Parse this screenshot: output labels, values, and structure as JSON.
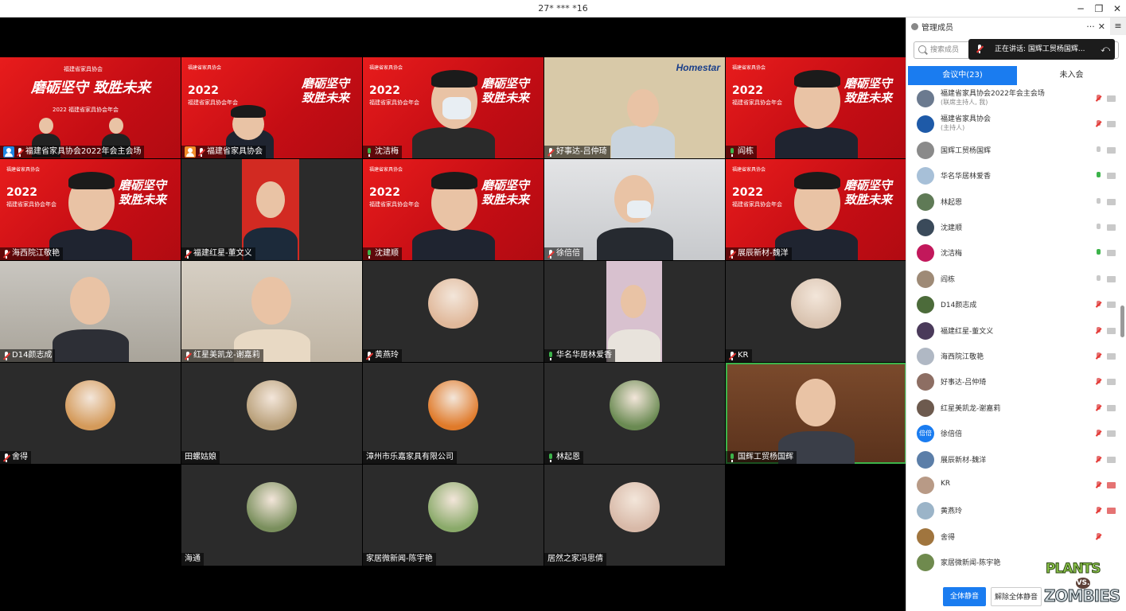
{
  "window": {
    "title": "27* *** *16"
  },
  "grid": {
    "tiles": [
      {
        "name": "福建省家具协会2022年会主会场",
        "mic": "muted",
        "host": "blue",
        "bg": "red"
      },
      {
        "name": "福建省家具协会",
        "mic": "muted",
        "host": "orange",
        "bg": "red"
      },
      {
        "name": "沈洁梅",
        "mic": "on",
        "bg": "red"
      },
      {
        "name": "好事达-吕仲琦",
        "mic": "muted",
        "bg": "pattern"
      },
      {
        "name": "阎栋",
        "mic": "on",
        "bg": "red"
      },
      {
        "name": "海西院江敬艳",
        "mic": "muted",
        "bg": "red"
      },
      {
        "name": "福建红星-董文义",
        "mic": "muted",
        "bg": "dark"
      },
      {
        "name": "沈建顺",
        "mic": "on",
        "bg": "red"
      },
      {
        "name": "徐倍倍",
        "mic": "muted",
        "bg": "office"
      },
      {
        "name": "展辰新材-魏洋",
        "mic": "muted",
        "bg": "red"
      },
      {
        "name": "D14颜志成",
        "mic": "muted",
        "bg": "room"
      },
      {
        "name": "红星美凯龙-谢嘉莉",
        "mic": "muted",
        "bg": "shelf"
      },
      {
        "name": "黄燕玲",
        "mic": "muted",
        "bg": "dark"
      },
      {
        "name": "华名华居林爱香",
        "mic": "on",
        "bg": "dark"
      },
      {
        "name": "KR",
        "mic": "muted",
        "bg": "dark"
      },
      {
        "name": "舍得",
        "mic": "muted",
        "bg": "dark"
      },
      {
        "name": "田螺姑娘",
        "mic": "",
        "bg": "dark"
      },
      {
        "name": "漳州市乐嘉家具有限公司",
        "mic": "",
        "bg": "dark"
      },
      {
        "name": "林起恩",
        "mic": "on",
        "bg": "dark"
      },
      {
        "name": "国辉工贸杨国辉",
        "mic": "on",
        "bg": "wood"
      },
      {
        "name": "海通",
        "mic": "",
        "bg": "dark"
      },
      {
        "name": "家居微新闻-陈宇艳",
        "mic": "",
        "bg": "dark"
      },
      {
        "name": "居然之家冯思倩",
        "mic": "",
        "bg": "dark"
      }
    ],
    "banner": {
      "year": "2022",
      "sub": "福建省家具协会年会",
      "slogan": "磨砺坚守 致胜未来",
      "logo": "福建省家具协会",
      "main_caption": "2022 福建省家具协会年会",
      "homestar": "Homestar"
    }
  },
  "panel": {
    "title": "管理成员",
    "more": "···",
    "close": "✕",
    "side": "≡",
    "search_placeholder": "搜索成员",
    "speaking": "正在讲话: 国辉工贸杨国辉...",
    "tabs": [
      {
        "label": "会议中(23)",
        "active": true
      },
      {
        "label": "未入会",
        "active": false
      }
    ],
    "members": [
      {
        "name": "福建省家具协会2022年会主会场",
        "role": "(联席主持人, 我)",
        "mic": "muted",
        "cam": "on",
        "color": "#6b7a8f"
      },
      {
        "name": "福建省家具协会",
        "role": "(主持人)",
        "mic": "muted",
        "cam": "on",
        "color": "#1e5aa8"
      },
      {
        "name": "国辉工贸杨国辉",
        "role": "",
        "mic": "idle",
        "cam": "on",
        "color": "#8a8a8a"
      },
      {
        "name": "华名华居林爱香",
        "role": "",
        "mic": "on",
        "cam": "on",
        "color": "#a7c0d8"
      },
      {
        "name": "林起恩",
        "role": "",
        "mic": "idle",
        "cam": "on",
        "color": "#5f7a56"
      },
      {
        "name": "沈建顺",
        "role": "",
        "mic": "idle",
        "cam": "on",
        "color": "#3a4a5a"
      },
      {
        "name": "沈洁梅",
        "role": "",
        "mic": "on",
        "cam": "on",
        "color": "#c2185b"
      },
      {
        "name": "阎栋",
        "role": "",
        "mic": "idle",
        "cam": "on",
        "color": "#9e8a76"
      },
      {
        "name": "D14颜志成",
        "role": "",
        "mic": "muted",
        "cam": "on",
        "color": "#4c6b3a"
      },
      {
        "name": "福建红星-董文义",
        "role": "",
        "mic": "muted",
        "cam": "on",
        "color": "#4a3a5a"
      },
      {
        "name": "海西院江敬艳",
        "role": "",
        "mic": "muted",
        "cam": "on",
        "color": "#b0b8c4"
      },
      {
        "name": "好事达-吕仲琦",
        "role": "",
        "mic": "muted",
        "cam": "on",
        "color": "#8d6e63"
      },
      {
        "name": "红星美凯龙-谢嘉莉",
        "role": "",
        "mic": "muted",
        "cam": "on",
        "color": "#6d5a4e"
      },
      {
        "name": "徐倍倍",
        "role": "",
        "mic": "muted",
        "cam": "on",
        "color": "#1a7cf0",
        "initials": "倍倍"
      },
      {
        "name": "展辰新材-魏洋",
        "role": "",
        "mic": "muted",
        "cam": "on",
        "color": "#5b7ea8"
      },
      {
        "name": "KR",
        "role": "",
        "mic": "muted",
        "cam": "off",
        "color": "#b89a86"
      },
      {
        "name": "黄燕玲",
        "role": "",
        "mic": "muted",
        "cam": "off",
        "color": "#9bb4c8"
      },
      {
        "name": "舍得",
        "role": "",
        "mic": "muted",
        "cam": "none",
        "color": "#a0753e"
      },
      {
        "name": "家居微新闻-陈宇艳",
        "role": "",
        "mic": "none",
        "cam": "none",
        "color": "#6f8a4e"
      }
    ],
    "mute_all": "全体静音",
    "unmute_all": "解除全体静音"
  },
  "overlay": {
    "line1": "PLANTS",
    "vs": "VS.",
    "line2": "ZOMBIES"
  },
  "colors": {
    "accent": "#1a7cf0",
    "banner_red": "#d7141a",
    "active_green": "#3cb34a"
  }
}
